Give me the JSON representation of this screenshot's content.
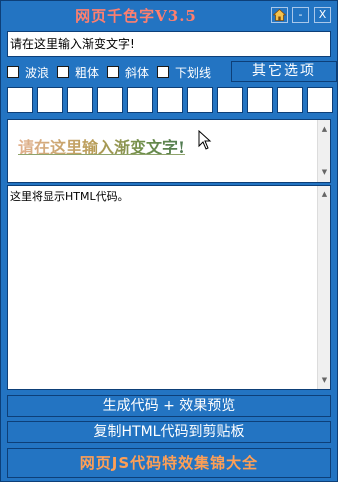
{
  "app": {
    "title": "网页千色字V3.5"
  },
  "titlebar": {
    "home_icon": "home-icon",
    "minimize_label": "-",
    "close_label": "X"
  },
  "input": {
    "value": "请在这里输入渐变文字!"
  },
  "options": [
    {
      "label": "波浪",
      "checked": false
    },
    {
      "label": "粗体",
      "checked": false
    },
    {
      "label": "斜体",
      "checked": false
    },
    {
      "label": "下划线",
      "checked": false
    }
  ],
  "other_options_label": "其它选项",
  "swatch_count": 11,
  "preview": {
    "text": "请在这里输入渐变文字!"
  },
  "code": {
    "placeholder": "这里将显示HTML代码。"
  },
  "buttons": {
    "generate": "生成代码 + 效果预览",
    "copy": "复制HTML代码到剪贴板",
    "js_collection": "网页JS代码特效集锦大全"
  },
  "colors": {
    "background": "#2374c2",
    "title": "#ff7f6e",
    "js_button_text": "#ff9f55"
  }
}
